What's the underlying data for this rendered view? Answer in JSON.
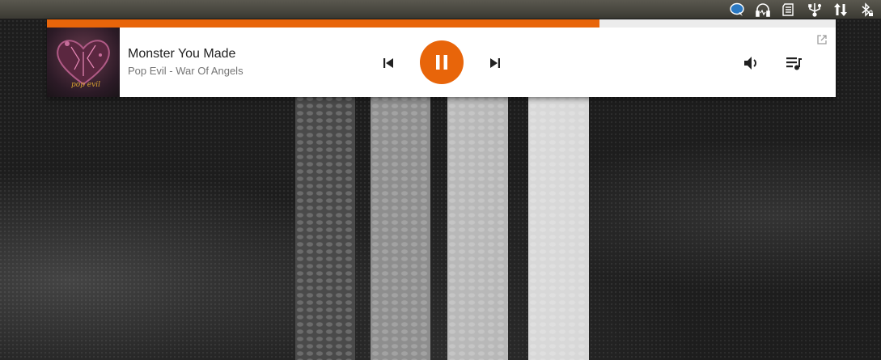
{
  "status_bar": {
    "icons": [
      "chat-bubble-icon",
      "headphones-icon",
      "sd-card-icon",
      "usb-icon",
      "data-transfer-icon",
      "bluetooth-lock-icon"
    ]
  },
  "player": {
    "progress": 0.7,
    "accent_color": "#e8650a",
    "album_art_text": "pop evil",
    "track": {
      "title": "Monster You Made",
      "subtitle": "Pop Evil - War Of Angels"
    },
    "controls": [
      "skip-previous-icon",
      "pause-icon",
      "skip-next-icon",
      "volume-icon",
      "queue-music-icon",
      "open-external-icon"
    ]
  }
}
